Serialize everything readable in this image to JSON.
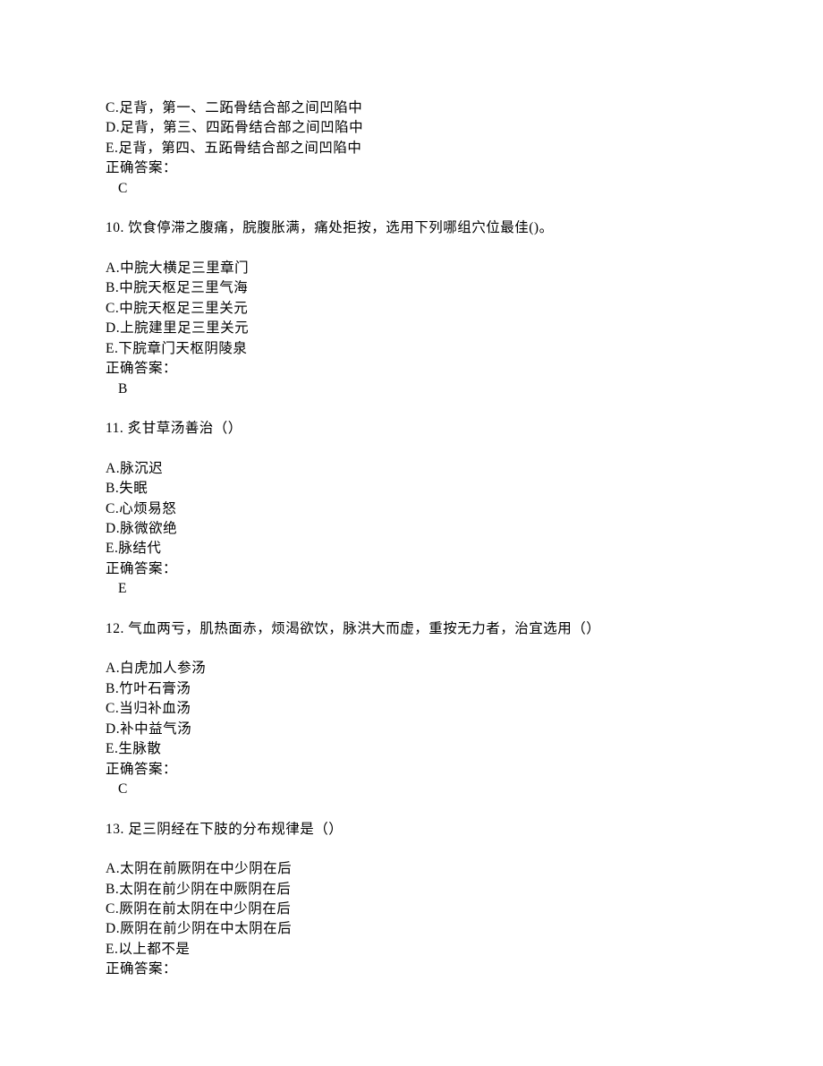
{
  "partial_header": {
    "options": [
      "C.足背，第一、二跖骨结合部之间凹陷中",
      "D.足背，第三、四跖骨结合部之间凹陷中",
      "E.足背，第四、五跖骨结合部之间凹陷中"
    ],
    "answer_label": "正确答案：",
    "answer": "C"
  },
  "questions": [
    {
      "num": "10.",
      "text": " 饮食停滞之腹痛，脘腹胀满，痛处拒按，选用下列哪组穴位最佳()。",
      "options": [
        "A.中脘大横足三里章门",
        "B.中脘天枢足三里气海",
        "C.中脘天枢足三里关元",
        "D.上脘建里足三里关元",
        "E.下脘章门天枢阴陵泉"
      ],
      "answer_label": "正确答案：",
      "answer": "B"
    },
    {
      "num": "11.",
      "text": " 炙甘草汤善治（）",
      "options": [
        "A.脉沉迟",
        "B.失眠",
        "C.心烦易怒",
        "D.脉微欲绝",
        "E.脉结代"
      ],
      "answer_label": "正确答案：",
      "answer": "E"
    },
    {
      "num": "12.",
      "text": " 气血两亏，肌热面赤，烦渴欲饮，脉洪大而虚，重按无力者，治宜选用（）",
      "options": [
        "A.白虎加人参汤",
        "B.竹叶石膏汤",
        "C.当归补血汤",
        "D.补中益气汤",
        "E.生脉散"
      ],
      "answer_label": "正确答案：",
      "answer": "C"
    },
    {
      "num": "13.",
      "text": " 足三阴经在下肢的分布规律是（）",
      "options": [
        "A.太阴在前厥阴在中少阴在后",
        "B.太阴在前少阴在中厥阴在后",
        "C.厥阴在前太阴在中少阴在后",
        "D.厥阴在前少阴在中太阴在后",
        "E.以上都不是"
      ],
      "answer_label": "正确答案：",
      "answer": ""
    }
  ]
}
